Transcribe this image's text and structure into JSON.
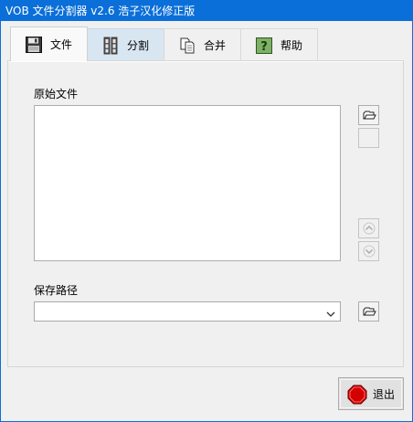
{
  "window": {
    "title": "VOB 文件分割器 v2.6 浩子汉化修正版"
  },
  "tabs": [
    {
      "label": "文件",
      "icon": "floppy-disk-icon",
      "state": "selected"
    },
    {
      "label": "分割",
      "icon": "film-split-icon",
      "state": "hover"
    },
    {
      "label": "合并",
      "icon": "documents-merge-icon",
      "state": "normal"
    },
    {
      "label": "帮助",
      "icon": "help-question-icon",
      "state": "normal"
    }
  ],
  "file_tab": {
    "source_label": "原始文件",
    "source_files": [],
    "save_path_label": "保存路径",
    "save_path_value": ""
  },
  "footer": {
    "exit_label": "退出",
    "exit_icon": "stop-sign-icon"
  },
  "colors": {
    "title_bar": "#0a6fd8",
    "tab_hover": "#d8e6f2",
    "stop_red": "#d40000",
    "help_green": "#7fb069"
  }
}
